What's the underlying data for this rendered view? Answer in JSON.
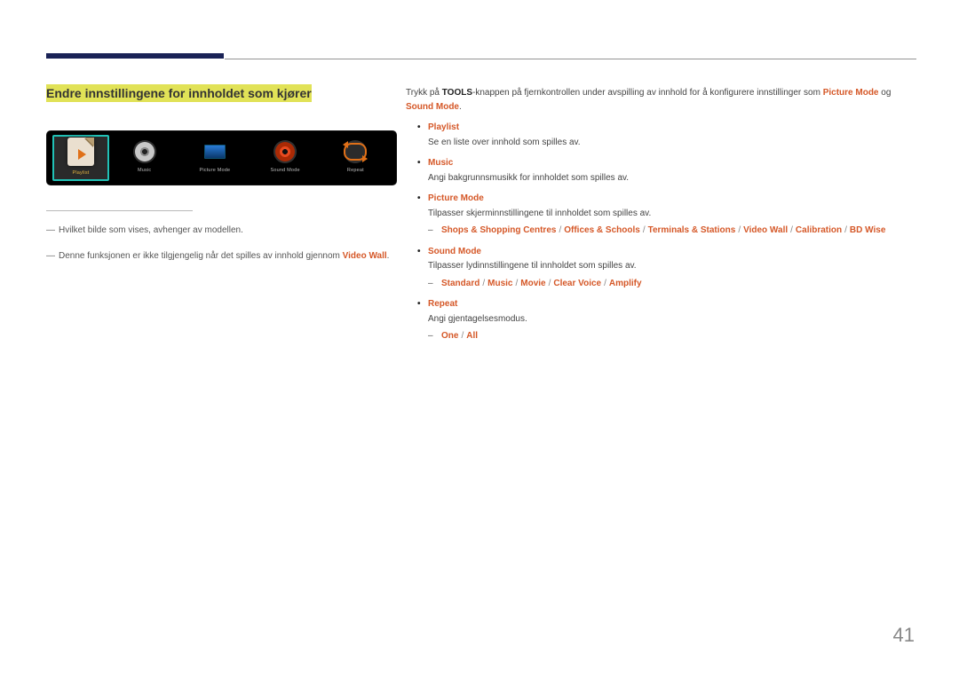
{
  "heading": "Endre innstillingene for innholdet som kjører",
  "toolbar": {
    "items": [
      {
        "label": "Playlist"
      },
      {
        "label": "Music"
      },
      {
        "label": "Picture Mode"
      },
      {
        "label": "Sound Mode"
      },
      {
        "label": "Repeat"
      }
    ]
  },
  "left_notes": {
    "n1": "Hvilket bilde som vises, avhenger av modellen.",
    "n2_pre": "Denne funksjonen er ikke tilgjengelig når det spilles av innhold gjennom ",
    "n2_hl": "Video Wall",
    "n2_post": "."
  },
  "intro": {
    "pre": "Trykk på ",
    "tools": "TOOLS",
    "mid": "-knappen på fjernkontrollen under avspilling av innhold for å konfigurere innstillinger som ",
    "pm": "Picture Mode",
    "og": " og ",
    "sm": "Sound Mode",
    "post": "."
  },
  "items": {
    "playlist": {
      "title": "Playlist",
      "desc": "Se en liste over innhold som spilles av."
    },
    "music": {
      "title": "Music",
      "desc": "Angi bakgrunnsmusikk for innholdet som spilles av."
    },
    "picture": {
      "title": "Picture Mode",
      "desc": "Tilpasser skjerminnstillingene til innholdet som spilles av.",
      "opts": [
        "Shops & Shopping Centres",
        "Offices & Schools",
        "Terminals & Stations",
        "Video Wall",
        "Calibration",
        "BD Wise"
      ]
    },
    "sound": {
      "title": "Sound Mode",
      "desc": "Tilpasser lydinnstillingene til innholdet som spilles av.",
      "opts": [
        "Standard",
        "Music",
        "Movie",
        "Clear Voice",
        "Amplify"
      ]
    },
    "repeat": {
      "title": "Repeat",
      "desc": "Angi gjentagelsesmodus.",
      "opts": [
        "One",
        "All"
      ]
    }
  },
  "page_number": "41"
}
